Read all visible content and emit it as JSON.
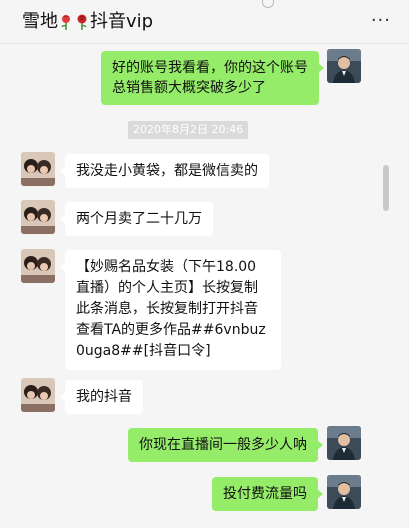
{
  "header": {
    "title_prefix": "雪地",
    "title_suffix": "抖音vip",
    "more_label": "···"
  },
  "messages": [
    {
      "side": "out",
      "text": "好的账号我看看，你的这个账号总销售额大概突破多少了"
    },
    {
      "type": "time",
      "text": "2020年8月2日 20:46"
    },
    {
      "side": "in",
      "text": "我没走小黄袋，都是微信卖的"
    },
    {
      "side": "in",
      "text": "两个月卖了二十几万"
    },
    {
      "side": "in",
      "text": "【妙赐名品女装（下午18.00直播）的个人主页】长按复制此条消息，长按复制打开抖音查看TA的更多作品##6vnbuz0uga8##[抖音口令]"
    },
    {
      "side": "in",
      "text": "我的抖音"
    },
    {
      "side": "out",
      "text": "你现在直播间一般多少人呐"
    },
    {
      "side": "out",
      "text": "投付费流量吗"
    }
  ],
  "colors": {
    "outgoing_bubble": "#95ec69",
    "incoming_bubble": "#ffffff",
    "background": "#f5f5f5"
  }
}
